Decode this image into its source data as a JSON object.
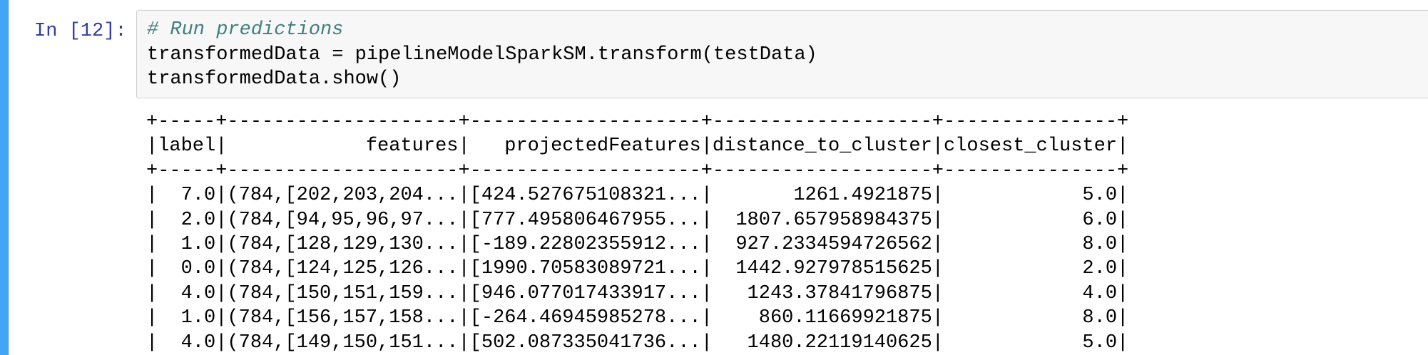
{
  "cell": {
    "prompt": "In [12]:",
    "code_lines": [
      {
        "text": "# Run predictions",
        "kind": "comment"
      },
      {
        "text": "transformedData = pipelineModelSparkSM.transform(testData)",
        "kind": "code"
      },
      {
        "text": "transformedData.show()",
        "kind": "code"
      }
    ]
  },
  "output": {
    "lines": [
      "+-----+--------------------+--------------------+-------------------+---------------+",
      "|label|            features|   projectedFeatures|distance_to_cluster|closest_cluster|",
      "+-----+--------------------+--------------------+-------------------+---------------+",
      "|  7.0|(784,[202,203,204...|[424.527675108321...|       1261.4921875|            5.0|",
      "|  2.0|(784,[94,95,96,97...|[777.495806467955...|  1807.657958984375|            6.0|",
      "|  1.0|(784,[128,129,130...|[-189.22802355912...|  927.2334594726562|            8.0|",
      "|  0.0|(784,[124,125,126...|[1990.70583089721...|  1442.927978515625|            2.0|",
      "|  4.0|(784,[150,151,159...|[946.077017433917...|   1243.37841796875|            4.0|",
      "|  1.0|(784,[156,157,158...|[-264.46945985278...|    860.11669921875|            8.0|",
      "|  4.0|(784,[149,150,151...|[502.087335041736...|   1480.22119140625|            5.0|"
    ]
  }
}
